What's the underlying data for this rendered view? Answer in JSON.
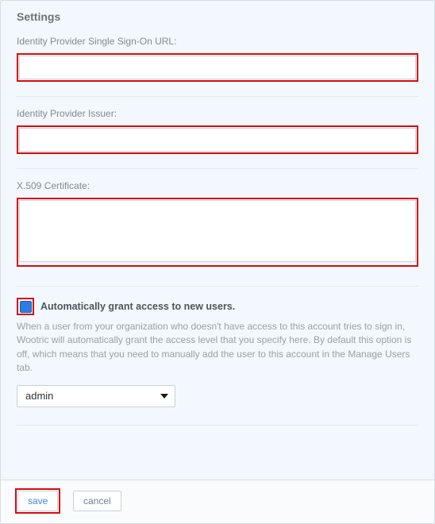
{
  "panel": {
    "title": "Settings"
  },
  "fields": {
    "sso_url": {
      "label": "Identity Provider Single Sign-On URL:",
      "value": ""
    },
    "issuer": {
      "label": "Identity Provider Issuer:",
      "value": ""
    },
    "cert": {
      "label": "X.509 Certificate:",
      "value": ""
    }
  },
  "auto_grant": {
    "checked": true,
    "label": "Automatically grant access to new users.",
    "help": "When a user from your organization who doesn't have access to this account tries to sign in, Wootric will automatically grant the access level that you specify here. By default this option is off, which means that you need to manually add the user to this account in the Manage Users tab.",
    "level_selected": "admin"
  },
  "buttons": {
    "save": "save",
    "cancel": "cancel"
  },
  "highlight_color": "#d90b0b"
}
